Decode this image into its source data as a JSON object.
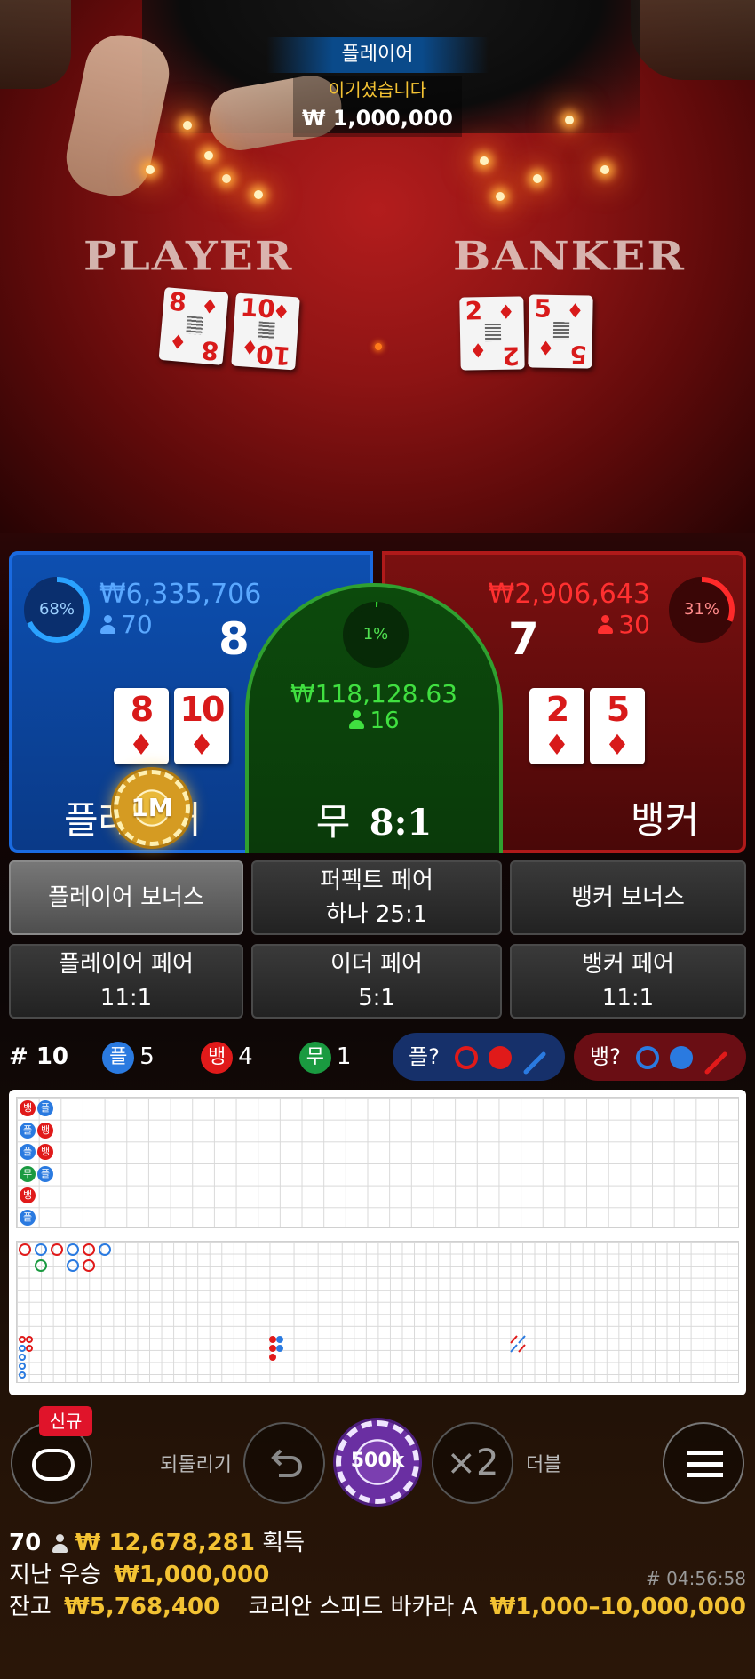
{
  "video": {
    "winner_banner": "플레이어",
    "win_text": "이기셨습니다",
    "win_amount": "₩ 1,000,000",
    "table_player_word": "PLAYER",
    "table_banker_word": "BANKER",
    "player_cards": [
      {
        "rank": "8",
        "suit": "♦"
      },
      {
        "rank": "10",
        "suit": "♦"
      }
    ],
    "banker_cards": [
      {
        "rank": "2",
        "suit": "♦"
      },
      {
        "rank": "5",
        "suit": "♦"
      }
    ]
  },
  "player": {
    "percent": "68%",
    "percent_value": 0.68,
    "amount": "₩6,335,706",
    "count": "70",
    "score": "8",
    "cards": [
      {
        "rank": "8",
        "suit": "♦"
      },
      {
        "rank": "10",
        "suit": "♦"
      }
    ],
    "label": "플레이어",
    "chip": "1M",
    "color": "#1a6ae0"
  },
  "tie": {
    "percent": "1%",
    "percent_value": 0.01,
    "amount": "₩118,128.63",
    "count": "16",
    "label": "무",
    "payout": "8:1",
    "color": "#30d030"
  },
  "banker": {
    "percent": "31%",
    "percent_value": 0.31,
    "amount": "₩2,906,643",
    "count": "30",
    "score": "7",
    "cards": [
      {
        "rank": "2",
        "suit": "♦"
      },
      {
        "rank": "5",
        "suit": "♦"
      }
    ],
    "label": "뱅커",
    "color": "#e01a1a"
  },
  "side_bets": {
    "player_bonus": "플레이어 보너스",
    "perfect_pair": {
      "line1": "퍼펙트 페어",
      "line2": "하나 25:1"
    },
    "banker_bonus": "뱅커 보너스",
    "player_pair": {
      "line1": "플레이어 페어",
      "line2": "11:1"
    },
    "either_pair": {
      "line1": "이더 페어",
      "line2": "5:1"
    },
    "banker_pair": {
      "line1": "뱅커 페어",
      "line2": "11:1"
    }
  },
  "stats": {
    "round_label": "# 10",
    "player_short": "플",
    "player_count": "5",
    "banker_short": "뱅",
    "banker_count": "4",
    "tie_short": "무",
    "tie_count": "1",
    "ask_player": "플?",
    "ask_banker": "뱅?"
  },
  "bead_road": [
    [
      {
        "t": "뱅",
        "c": "#e01a1a"
      },
      {
        "t": "플",
        "c": "#2a7ae0"
      }
    ],
    [
      {
        "t": "플",
        "c": "#2a7ae0"
      },
      {
        "t": "뱅",
        "c": "#e01a1a"
      }
    ],
    [
      {
        "t": "플",
        "c": "#2a7ae0"
      },
      {
        "t": "뱅",
        "c": "#e01a1a"
      }
    ],
    [
      {
        "t": "무",
        "c": "#1a9a40"
      },
      {
        "t": "플",
        "c": "#2a7ae0"
      }
    ],
    [
      {
        "t": "뱅",
        "c": "#e01a1a"
      }
    ],
    [
      {
        "t": "플",
        "c": "#2a7ae0"
      }
    ]
  ],
  "controls": {
    "new_badge": "신규",
    "undo_label": "되돌리기",
    "chip_value": "500k",
    "double_symbol": "×2",
    "double_label": "더블"
  },
  "footer": {
    "players": "70",
    "total_win": "₩ 12,678,281",
    "win_suffix": "획득",
    "last_winner_label": "지난 우승",
    "last_winner_amount": "₩1,000,000",
    "round_id": "# 04:56:58",
    "balance_label": "잔고",
    "balance": "₩5,768,400",
    "table_name": "코리안 스피드 바카라 A",
    "limits": "₩1,000–10,000,000"
  }
}
